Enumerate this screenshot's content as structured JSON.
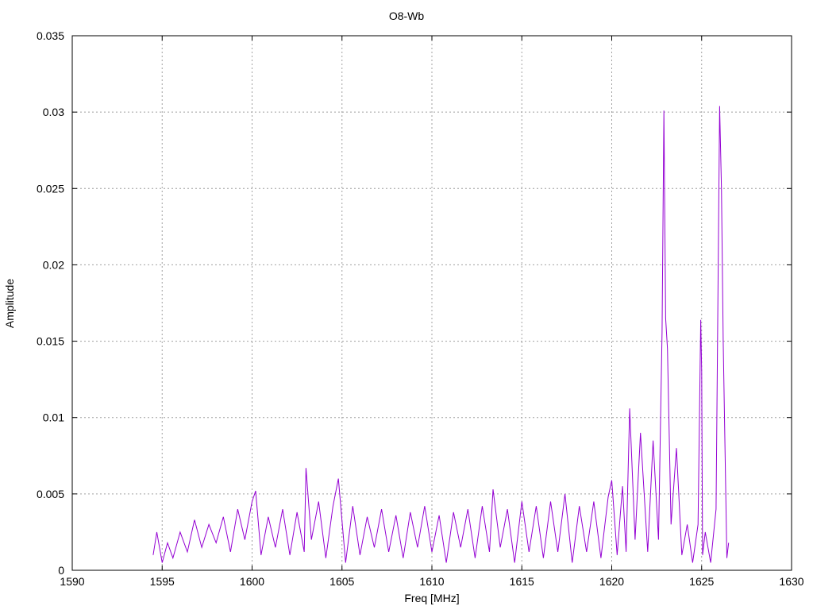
{
  "chart_data": {
    "type": "line",
    "title": "O8-Wb",
    "xlabel": "Freq [MHz]",
    "ylabel": "Amplitude",
    "xlim": [
      1590,
      1630
    ],
    "ylim": [
      0,
      0.035
    ],
    "xticks": [
      1590,
      1595,
      1600,
      1605,
      1610,
      1615,
      1620,
      1625,
      1630
    ],
    "yticks": [
      0,
      0.005,
      0.01,
      0.015,
      0.02,
      0.025,
      0.03,
      0.035
    ],
    "xtick_labels": [
      "1590",
      "1595",
      "1600",
      "1605",
      "1610",
      "1615",
      "1620",
      "1625",
      "1630"
    ],
    "ytick_labels": [
      "0",
      "0.005",
      "0.01",
      "0.015",
      "0.02",
      "0.025",
      "0.03",
      "0.035"
    ],
    "grid": true,
    "series": [
      {
        "color": "#9400d3",
        "x": [
          1594.5,
          1594.7,
          1595.0,
          1595.3,
          1595.6,
          1596.0,
          1596.4,
          1596.8,
          1597.2,
          1597.6,
          1598.0,
          1598.4,
          1598.8,
          1599.2,
          1599.6,
          1600.0,
          1600.2,
          1600.5,
          1600.9,
          1601.3,
          1601.7,
          1602.1,
          1602.5,
          1602.9,
          1603.0,
          1603.3,
          1603.7,
          1604.1,
          1604.5,
          1604.8,
          1605.2,
          1605.6,
          1606.0,
          1606.4,
          1606.8,
          1607.2,
          1607.6,
          1608.0,
          1608.4,
          1608.8,
          1609.2,
          1609.6,
          1610.0,
          1610.4,
          1610.8,
          1611.2,
          1611.6,
          1612.0,
          1612.4,
          1612.8,
          1613.2,
          1613.4,
          1613.8,
          1614.2,
          1614.6,
          1615.0,
          1615.4,
          1615.8,
          1616.2,
          1616.6,
          1617.0,
          1617.4,
          1617.8,
          1618.2,
          1618.6,
          1619.0,
          1619.4,
          1619.8,
          1620.0,
          1620.3,
          1620.6,
          1620.8,
          1621.0,
          1621.3,
          1621.6,
          1622.0,
          1622.3,
          1622.6,
          1622.8,
          1622.9,
          1623.0,
          1623.1,
          1623.3,
          1623.6,
          1623.9,
          1624.2,
          1624.5,
          1624.8,
          1624.95,
          1625.0,
          1625.05,
          1625.2,
          1625.5,
          1625.8,
          1626.0,
          1626.1,
          1626.2,
          1626.4,
          1626.5
        ],
        "y": [
          0.001,
          0.0025,
          0.0005,
          0.0018,
          0.0008,
          0.0025,
          0.0012,
          0.0033,
          0.0015,
          0.003,
          0.0018,
          0.0035,
          0.0012,
          0.004,
          0.002,
          0.0045,
          0.0052,
          0.001,
          0.0035,
          0.0015,
          0.004,
          0.001,
          0.0038,
          0.0012,
          0.0067,
          0.002,
          0.0045,
          0.0008,
          0.0042,
          0.006,
          0.0005,
          0.0042,
          0.001,
          0.0035,
          0.0015,
          0.004,
          0.0012,
          0.0036,
          0.0008,
          0.0038,
          0.0015,
          0.0042,
          0.0012,
          0.0036,
          0.0005,
          0.0038,
          0.0015,
          0.004,
          0.0008,
          0.0042,
          0.0012,
          0.0053,
          0.0015,
          0.004,
          0.0005,
          0.0045,
          0.0012,
          0.0042,
          0.0008,
          0.0045,
          0.0012,
          0.005,
          0.0005,
          0.0042,
          0.0012,
          0.0045,
          0.0008,
          0.0048,
          0.0059,
          0.001,
          0.0055,
          0.0012,
          0.0106,
          0.002,
          0.009,
          0.0012,
          0.0085,
          0.002,
          0.0156,
          0.0301,
          0.0165,
          0.0145,
          0.003,
          0.008,
          0.001,
          0.003,
          0.0005,
          0.003,
          0.0164,
          0.013,
          0.001,
          0.0025,
          0.0005,
          0.004,
          0.0304,
          0.025,
          0.015,
          0.0008,
          0.0018
        ]
      }
    ]
  }
}
